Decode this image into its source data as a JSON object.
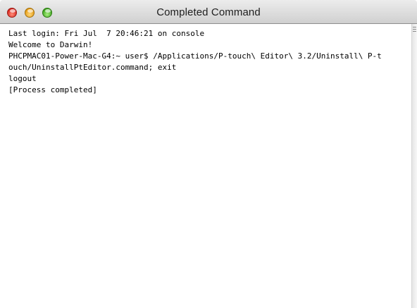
{
  "window": {
    "title": "Completed Command"
  },
  "titlebar": {
    "buttons": [
      {
        "name": "close",
        "color": "#d9261e"
      },
      {
        "name": "minimize",
        "color": "#e39a12"
      },
      {
        "name": "zoom",
        "color": "#3ea51e"
      }
    ]
  },
  "terminal": {
    "lines": [
      "Last login: Fri Jul  7 20:46:21 on console",
      "Welcome to Darwin!",
      "PHCPMAC01-Power-Mac-G4:~ user$ /Applications/P-touch\\ Editor\\ 3.2/Uninstall\\ P-t",
      "ouch/UninstallPtEditor.command; exit",
      "logout",
      "[Process completed]"
    ]
  }
}
